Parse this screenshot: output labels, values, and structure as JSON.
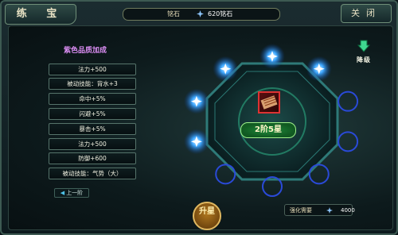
{
  "window": {
    "title": "练 宝",
    "close_label": "关闭"
  },
  "currency": {
    "label": "铭石",
    "icon": "diamond-icon",
    "value": "620铭石"
  },
  "bonus": {
    "title": "紫色品质加成",
    "stats": [
      "法力+500",
      "被动技能：背水+3",
      "命中+5%",
      "闪避+5%",
      "暴击+5%",
      "法力+500",
      "防御+600",
      "被动技能：气势（大）"
    ]
  },
  "prev_button": {
    "label": "上一阶",
    "icon": "left-arrow-icon"
  },
  "center": {
    "level": "2阶5星",
    "item_icon": "treasure-scroll-icon"
  },
  "downgrade": {
    "label": "降级",
    "icon": "down-arrow-icon"
  },
  "upgrade_button": {
    "label": "升星"
  },
  "cost": {
    "label": "强化需要",
    "icon": "diamond-icon",
    "value": "4000"
  },
  "stars": {
    "total": 10,
    "lit": 5
  },
  "colors": {
    "accent_gold": "#e0b860",
    "purple_quality": "#d88cf0",
    "star_glow": "#3fa8ff",
    "badge_green": "#1f8a3a"
  }
}
